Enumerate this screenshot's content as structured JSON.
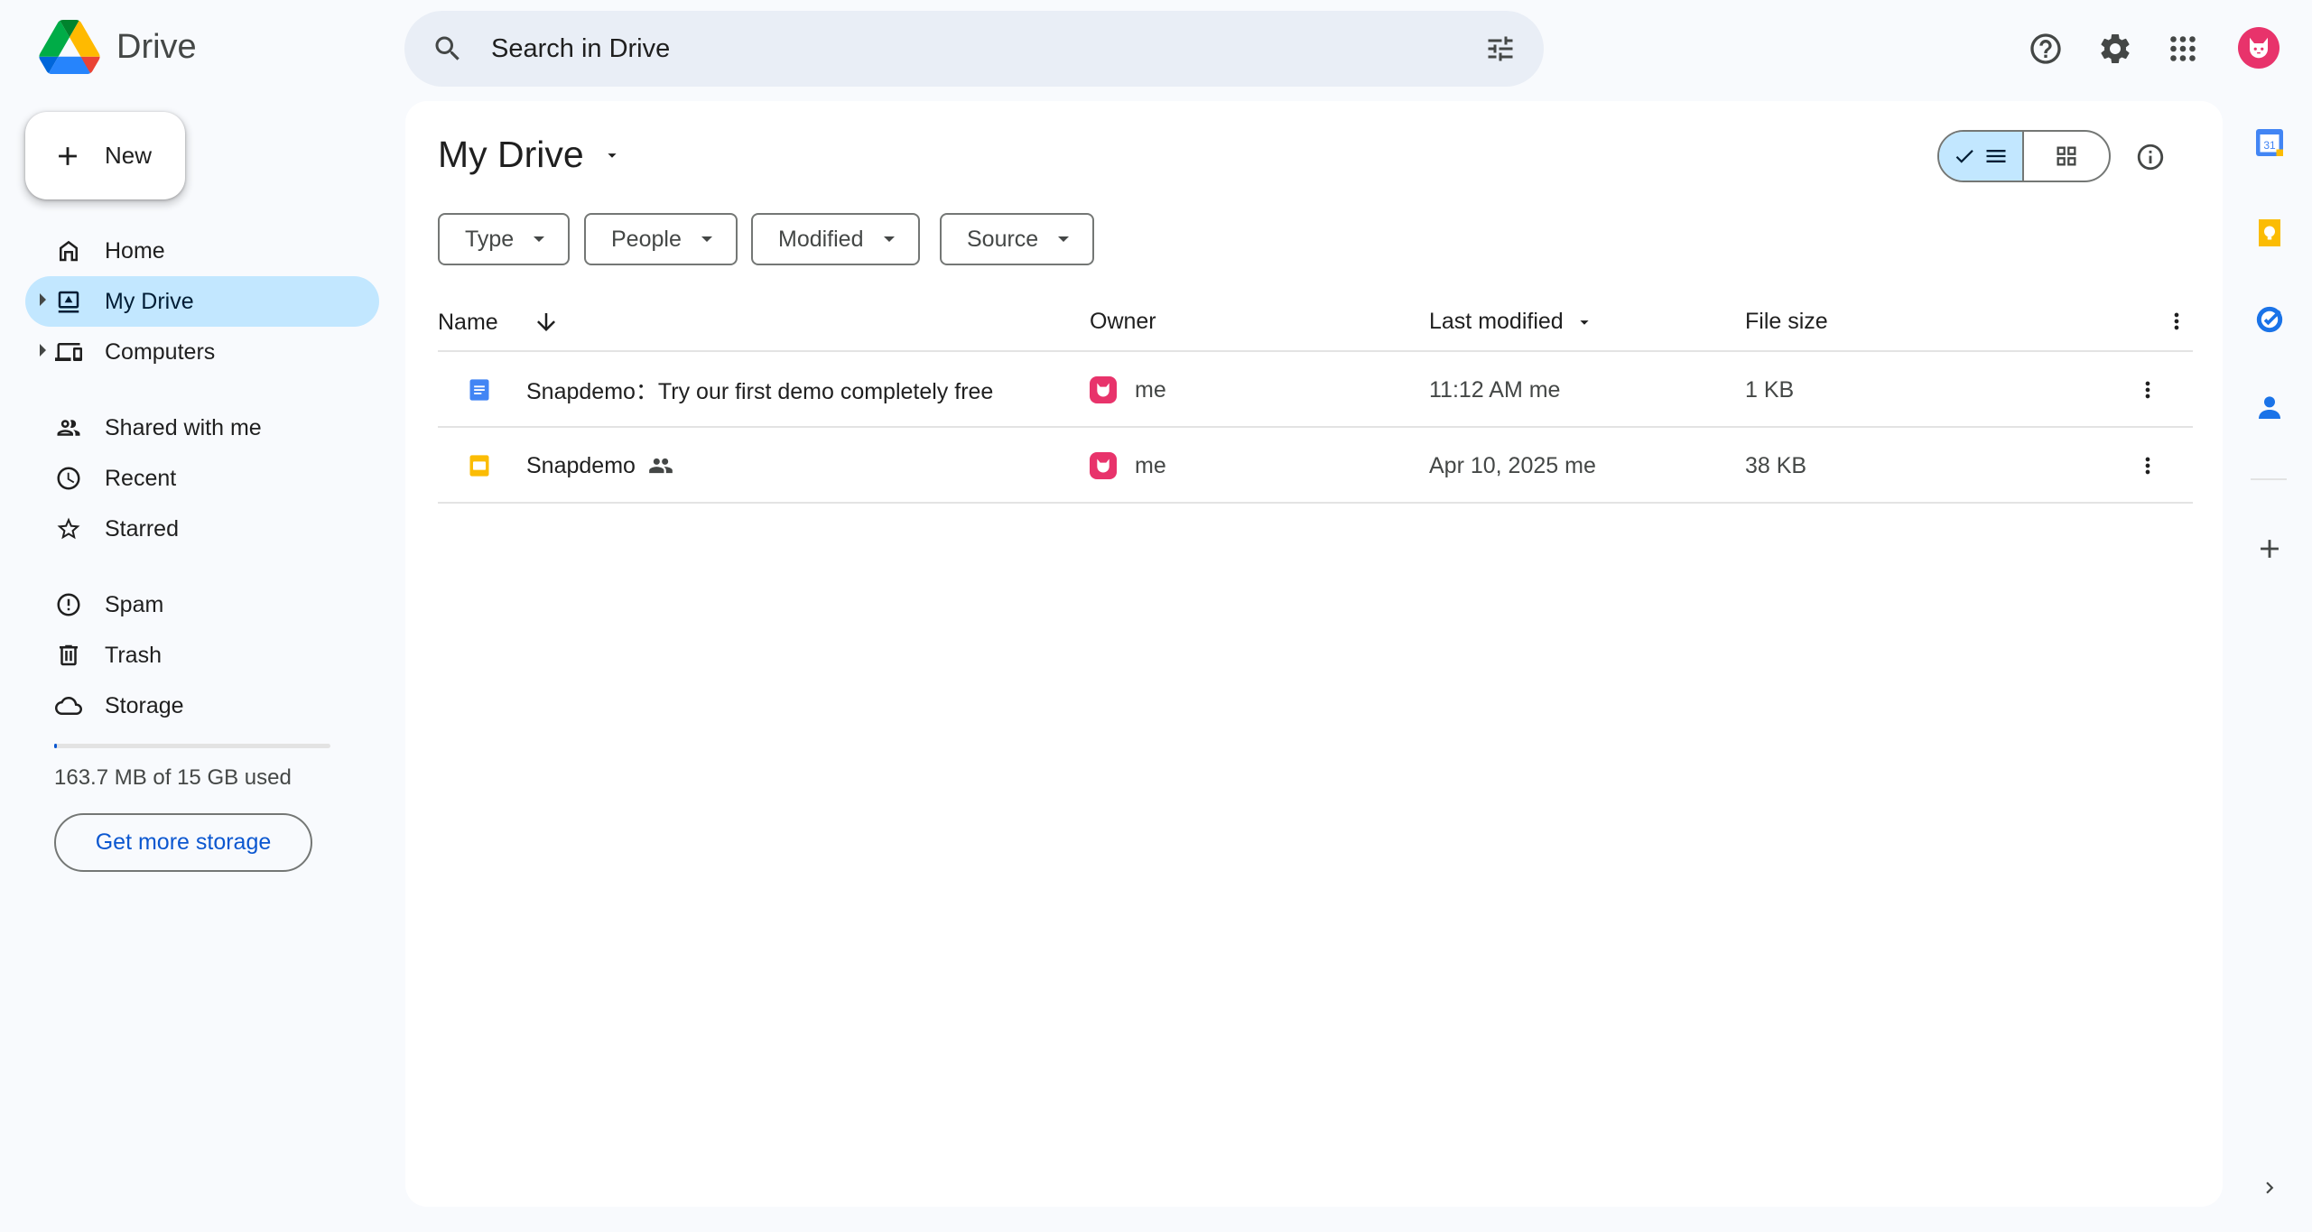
{
  "app": {
    "name": "Drive"
  },
  "search": {
    "placeholder": "Search in Drive"
  },
  "sidebar": {
    "new_label": "New",
    "items": [
      {
        "label": "Home"
      },
      {
        "label": "My Drive"
      },
      {
        "label": "Computers"
      },
      {
        "label": "Shared with me"
      },
      {
        "label": "Recent"
      },
      {
        "label": "Starred"
      },
      {
        "label": "Spam"
      },
      {
        "label": "Trash"
      },
      {
        "label": "Storage"
      }
    ],
    "storage_used_fraction": 0.011,
    "storage_text": "163.7 MB of 15 GB used",
    "get_more_storage": "Get more storage"
  },
  "main": {
    "title": "My Drive",
    "filters": [
      "Type",
      "People",
      "Modified",
      "Source"
    ],
    "columns": {
      "name": "Name",
      "owner": "Owner",
      "last_modified": "Last modified",
      "file_size": "File size"
    },
    "files": [
      {
        "name": "Snapdemo：Try our first demo completely free",
        "icon": "google-docs-icon",
        "owner": "me",
        "modified": "11:12 AM",
        "modified_by": "me",
        "size": "1 KB",
        "shared": false
      },
      {
        "name": "Snapdemo",
        "icon": "google-slides-icon",
        "owner": "me",
        "modified": "Apr 10, 2025",
        "modified_by": "me",
        "size": "38 KB",
        "shared": true
      }
    ]
  },
  "colors": {
    "accent": "#0b57d0",
    "selected": "#c2e7ff",
    "avatar": "#e8336b",
    "docs": "#4285f4",
    "slides": "#fbbc04"
  }
}
